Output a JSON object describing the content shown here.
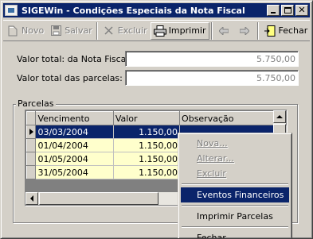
{
  "window": {
    "title": "SIGEWin - Condições Especiais da Nota Fiscal"
  },
  "toolbar": {
    "novo": "Novo",
    "salvar": "Salvar",
    "excluir": "Excluir",
    "imprimir": "Imprimir",
    "fechar": "Fechar"
  },
  "form": {
    "valor_nota_label": "Valor total: da Nota Fiscal",
    "valor_nota_value": "5.750,00",
    "valor_parcelas_label": "Valor total das parcelas:",
    "valor_parcelas_value": "5.750,00"
  },
  "parcelas": {
    "title": "Parcelas",
    "columns": [
      "Vencimento",
      "Valor",
      "Observação"
    ],
    "rows": [
      {
        "vencimento": "03/03/2004",
        "valor": "1.150,00",
        "obs": ""
      },
      {
        "vencimento": "01/04/2004",
        "valor": "1.150,00",
        "obs": ""
      },
      {
        "vencimento": "01/05/2004",
        "valor": "1.150,00",
        "obs": ""
      },
      {
        "vencimento": "31/05/2004",
        "valor": "1.150,00",
        "obs": ""
      }
    ]
  },
  "context_menu": {
    "nova": "Nova...",
    "alterar": "Alterar...",
    "excluir": "Excluir",
    "eventos": "Eventos Financeiros",
    "imprimir": "Imprimir Parcelas",
    "fechar": "Fechar"
  }
}
